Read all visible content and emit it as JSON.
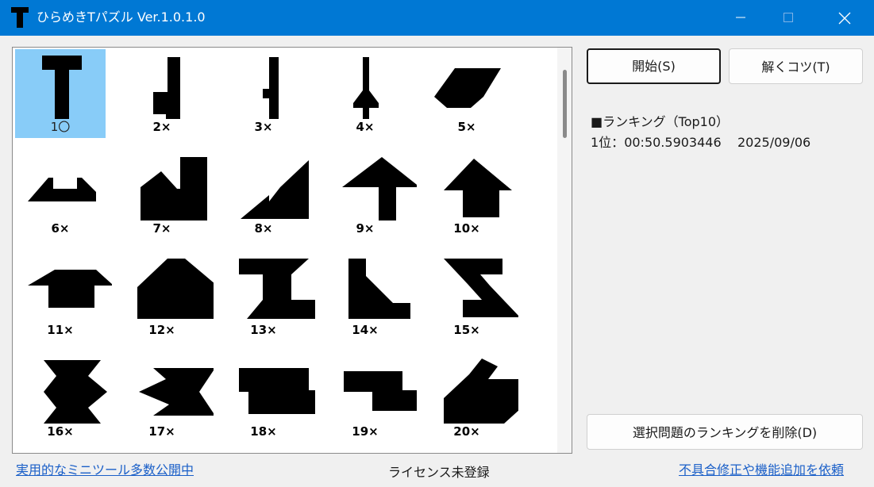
{
  "window": {
    "title": "ひらめきTパズル Ver.1.0.1.0",
    "accent": "#0078d4"
  },
  "puzzles": [
    {
      "id": "p1",
      "label": "1〇",
      "selected": true
    },
    {
      "id": "p2",
      "label": "2×"
    },
    {
      "id": "p3",
      "label": "3×"
    },
    {
      "id": "p4",
      "label": "4×"
    },
    {
      "id": "p5",
      "label": "5×"
    },
    {
      "id": "p6",
      "label": "6×"
    },
    {
      "id": "p7",
      "label": "7×"
    },
    {
      "id": "p8",
      "label": "8×"
    },
    {
      "id": "p9",
      "label": "9×"
    },
    {
      "id": "p10",
      "label": "10×"
    },
    {
      "id": "p11",
      "label": "11×"
    },
    {
      "id": "p12",
      "label": "12×"
    },
    {
      "id": "p13",
      "label": "13×"
    },
    {
      "id": "p14",
      "label": "14×"
    },
    {
      "id": "p15",
      "label": "15×"
    },
    {
      "id": "p16",
      "label": "16×"
    },
    {
      "id": "p17",
      "label": "17×"
    },
    {
      "id": "p18",
      "label": "18×"
    },
    {
      "id": "p19",
      "label": "19×"
    },
    {
      "id": "p20",
      "label": "20×"
    }
  ],
  "buttons": {
    "start": "開始(S)",
    "tips": "解くコツ(T)",
    "delete_ranking": "選択問題のランキングを削除(D)"
  },
  "ranking": {
    "title": "■ランキング（Top10）",
    "rows": [
      {
        "rank": "1位：",
        "time": "00:50.5903446",
        "date": "2025/09/06"
      }
    ]
  },
  "footer": {
    "left_link": "実用的なミニツール多数公開中",
    "center_status": "ライセンス未登録",
    "right_link": "不具合修正や機能追加を依頼"
  }
}
